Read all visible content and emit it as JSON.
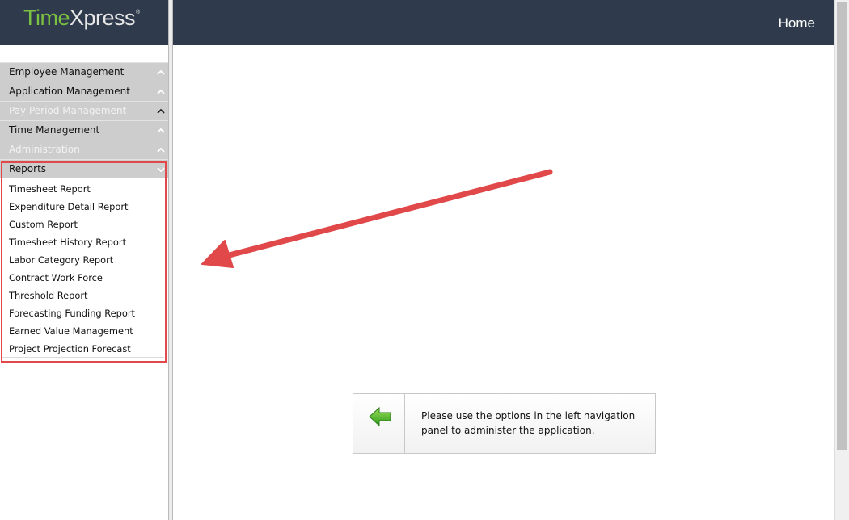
{
  "app": {
    "logo_part1": "Time",
    "logo_part2": "Xpress",
    "logo_mark": "®",
    "brand_color": "#7cc043",
    "header_color": "#2f3b4c"
  },
  "topbar": {
    "home_label": "Home"
  },
  "nav": {
    "sections": [
      {
        "label": "Employee Management",
        "icon": "chevron-up-icon"
      },
      {
        "label": "Application Management",
        "icon": "chevron-up-icon"
      },
      {
        "label": "Pay Period Management",
        "icon": "chevron-up-icon"
      },
      {
        "label": "Time Management",
        "icon": "chevron-up-icon"
      },
      {
        "label": "Administration",
        "icon": "chevron-up-icon"
      }
    ],
    "reports": {
      "label": "Reports",
      "icon": "chevron-down-icon",
      "items": [
        "Timesheet Report",
        "Expenditure Detail Report",
        "Custom Report",
        "Timesheet History Report",
        "Labor Category Report",
        "Contract Work Force",
        "Threshold Report",
        "Forecasting Funding Report",
        "Earned Value Management",
        "Project Projection Forecast"
      ]
    }
  },
  "main": {
    "info_message": "Please use the options in the left navigation panel to administer the application.",
    "info_icon": "green-left-arrow-icon"
  },
  "annotation": {
    "highlight_color": "#e0484a",
    "arrow_icon": "red-annotation-arrow"
  }
}
